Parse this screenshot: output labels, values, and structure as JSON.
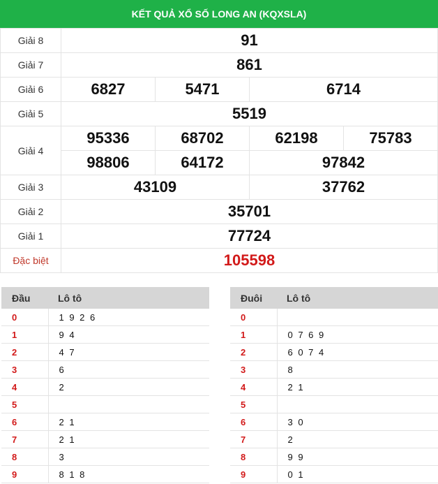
{
  "title": "KẾT QUẢ XỔ SỐ LONG AN (KQXSLA)",
  "prizes": {
    "g8": {
      "label": "Giải 8",
      "n": [
        "91"
      ]
    },
    "g7": {
      "label": "Giải 7",
      "n": [
        "861"
      ]
    },
    "g6": {
      "label": "Giải 6",
      "n": [
        "6827",
        "5471",
        "6714"
      ]
    },
    "g5": {
      "label": "Giải 5",
      "n": [
        "5519"
      ]
    },
    "g4": {
      "label": "Giải 4",
      "n": [
        "95336",
        "68702",
        "62198",
        "75783",
        "98806",
        "64172",
        "97842"
      ]
    },
    "g3": {
      "label": "Giải 3",
      "n": [
        "43109",
        "37762"
      ]
    },
    "g2": {
      "label": "Giải 2",
      "n": [
        "35701"
      ]
    },
    "g1": {
      "label": "Giải 1",
      "n": [
        "77724"
      ]
    },
    "db": {
      "label": "Đặc biệt",
      "n": [
        "105598"
      ]
    }
  },
  "head_table": {
    "col1": "Đầu",
    "col2": "Lô tô",
    "rows": [
      {
        "k": "0",
        "v": "1 9 2 6"
      },
      {
        "k": "1",
        "v": "9 4"
      },
      {
        "k": "2",
        "v": "4 7"
      },
      {
        "k": "3",
        "v": "6"
      },
      {
        "k": "4",
        "v": "2"
      },
      {
        "k": "5",
        "v": ""
      },
      {
        "k": "6",
        "v": "2 1"
      },
      {
        "k": "7",
        "v": "2 1"
      },
      {
        "k": "8",
        "v": "3"
      },
      {
        "k": "9",
        "v": "8 1 8"
      }
    ]
  },
  "tail_table": {
    "col1": "Đuôi",
    "col2": "Lô tô",
    "rows": [
      {
        "k": "0",
        "v": ""
      },
      {
        "k": "1",
        "v": "0 7 6 9"
      },
      {
        "k": "2",
        "v": "6 0 7 4"
      },
      {
        "k": "3",
        "v": "8"
      },
      {
        "k": "4",
        "v": "2 1"
      },
      {
        "k": "5",
        "v": ""
      },
      {
        "k": "6",
        "v": "3 0"
      },
      {
        "k": "7",
        "v": "2"
      },
      {
        "k": "8",
        "v": "9 9"
      },
      {
        "k": "9",
        "v": "0 1"
      }
    ]
  }
}
